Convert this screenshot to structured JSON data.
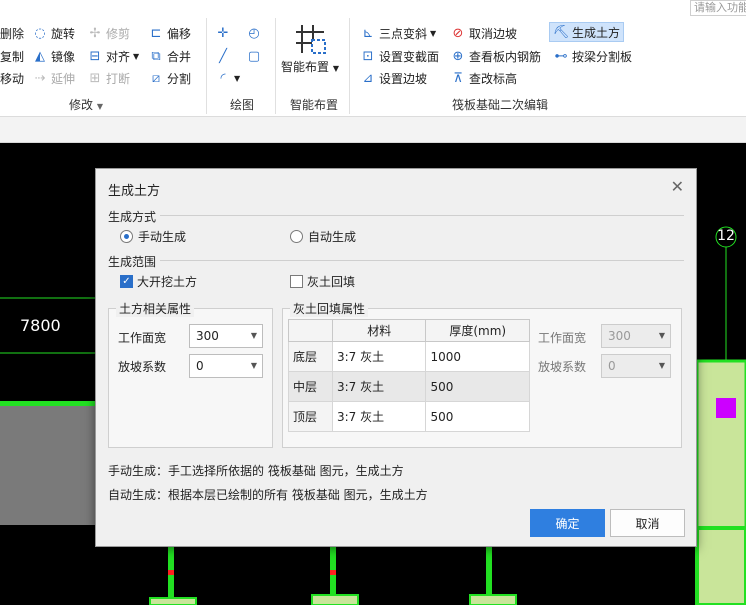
{
  "search": {
    "placeholder": "请输入功能"
  },
  "ribbon": {
    "modify": {
      "delete": "删除",
      "copy": "复制",
      "move": "移动",
      "rotate": "旋转",
      "mirror": "镜像",
      "extend": "延伸",
      "trim": "修剪",
      "align": "对齐",
      "break": "打断",
      "offset": "偏移",
      "merge": "合并",
      "split": "分割",
      "group_label": "修改"
    },
    "draw": {
      "group_label": "绘图"
    },
    "smart": {
      "button_label": "智能布置",
      "group_label": "智能布置"
    },
    "raft_edit": {
      "three_point_slope": "三点变斜",
      "set_section": "设置变截面",
      "set_edge_slope": "设置边坡",
      "cancel_edge_slope": "取消边坡",
      "view_rebar": "查看板内钢筋",
      "view_elevation": "查改标高",
      "gen_earthwork": "生成土方",
      "split_by_beam": "按梁分割板",
      "group_label": "筏板基础二次编辑"
    }
  },
  "canvas": {
    "dimension_text": "7800",
    "axis_label": "12"
  },
  "dialog": {
    "title": "生成土方",
    "method": {
      "title": "生成方式",
      "manual_label": "手动生成",
      "manual_selected": true,
      "auto_label": "自动生成",
      "auto_selected": false
    },
    "scope": {
      "title": "生成范围",
      "excavation_label": "大开挖土方",
      "excavation_checked": true,
      "backfill_label": "灰土回填",
      "backfill_checked": false
    },
    "earthwork_props": {
      "title": "土方相关属性",
      "work_width_label": "工作面宽",
      "work_width_value": "300",
      "slope_label": "放坡系数",
      "slope_value": "0"
    },
    "backfill_props": {
      "title": "灰土回填属性",
      "columns": [
        "材料",
        "厚度(mm)"
      ],
      "rows": [
        {
          "name": "底层",
          "material": "3:7 灰土",
          "thickness": "1000"
        },
        {
          "name": "中层",
          "material": "3:7 灰土",
          "thickness": "500"
        },
        {
          "name": "顶层",
          "material": "3:7 灰土",
          "thickness": "500"
        }
      ],
      "work_width_label": "工作面宽",
      "work_width_value": "300",
      "slope_label": "放坡系数",
      "slope_value": "0"
    },
    "notes": {
      "manual": "手动生成：手工选择所依据的 筏板基础 图元，生成土方",
      "auto": "自动生成：根据本层已绘制的所有 筏板基础 图元，生成土方"
    },
    "ok_label": "确定",
    "cancel_label": "取消"
  },
  "colors": {
    "accent": "#2f7fe0",
    "cad_green": "#22e022",
    "cad_magenta": "#cc00ff"
  }
}
